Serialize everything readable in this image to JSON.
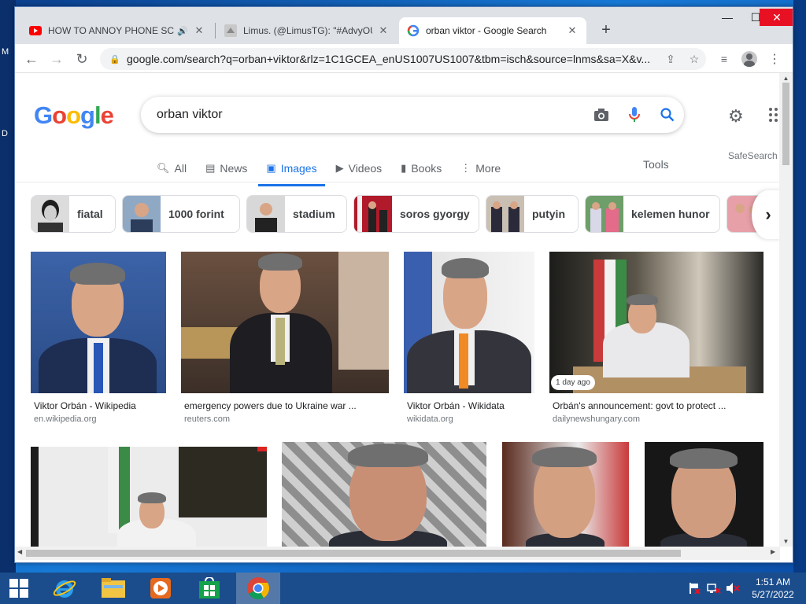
{
  "browser": {
    "tabs": [
      {
        "title": "HOW TO ANNOY PHONE SC",
        "favicon": "youtube-icon",
        "audio": true
      },
      {
        "title": "Limus. (@LimusTG): \"#AdvyOUT",
        "favicon": "twitter-icon"
      },
      {
        "title": "orban viktor - Google Search",
        "favicon": "google-icon",
        "active": true
      }
    ],
    "url": "google.com/search?q=orban+viktor&rlz=1C1GCEA_enUS1007US1007&tbm=isch&source=lnms&sa=X&v..."
  },
  "search": {
    "logo_letters": [
      "G",
      "o",
      "o",
      "g",
      "l",
      "e"
    ],
    "logo_colors": [
      "#4285f4",
      "#ea4335",
      "#fbbc05",
      "#4285f4",
      "#34a853",
      "#ea4335"
    ],
    "query": "orban viktor"
  },
  "nav": {
    "tabs": [
      {
        "label": "All",
        "icon": "search-icon"
      },
      {
        "label": "News",
        "icon": "news-icon"
      },
      {
        "label": "Images",
        "icon": "image-icon",
        "active": true
      },
      {
        "label": "Videos",
        "icon": "video-icon"
      },
      {
        "label": "Books",
        "icon": "book-icon"
      },
      {
        "label": "More",
        "icon": "more-icon"
      }
    ],
    "tools": "Tools",
    "safesearch": "SafeSearch"
  },
  "chips": [
    "fiatal",
    "1000 forint",
    "stadium",
    "soros gyorgy",
    "putyin",
    "kelemen hunor"
  ],
  "results": [
    {
      "caption": "Viktor Orbán - Wikipedia",
      "source": "en.wikipedia.org"
    },
    {
      "caption": "emergency powers due to Ukraine war ...",
      "source": "reuters.com"
    },
    {
      "caption": "Viktor Orbán - Wikidata",
      "source": "wikidata.org"
    },
    {
      "caption": "Orbán's announcement: govt to protect ...",
      "source": "dailynewshungary.com",
      "badge": "1 day ago"
    }
  ],
  "taskbar": {
    "apps": [
      "start-button",
      "internet-explorer-icon",
      "file-explorer-icon",
      "media-player-icon",
      "store-icon",
      "chrome-icon"
    ],
    "time": "1:51 AM",
    "date": "5/27/2022"
  },
  "colors": {
    "accent": "#1a73e8",
    "tab_strip": "#dee1e6",
    "close_button": "#e81123",
    "taskbar": "#1b4d8c"
  }
}
